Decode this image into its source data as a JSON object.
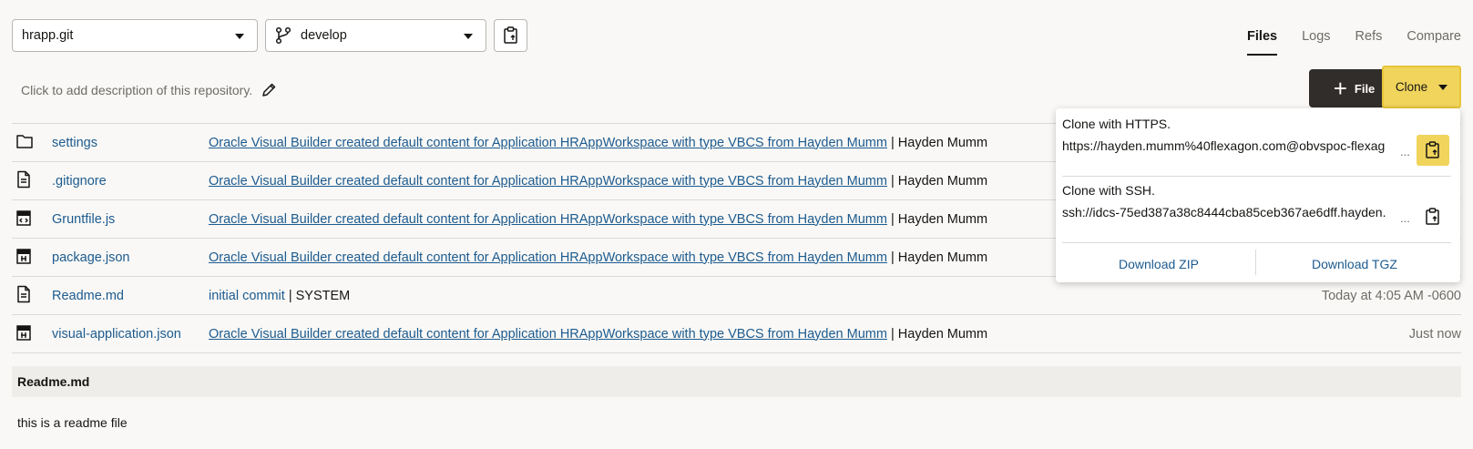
{
  "repo_select": {
    "value": "hrapp.git"
  },
  "branch_select": {
    "value": "develop"
  },
  "tabs": [
    {
      "label": "Files",
      "active": true
    },
    {
      "label": "Logs",
      "active": false
    },
    {
      "label": "Refs",
      "active": false
    },
    {
      "label": "Compare",
      "active": false
    }
  ],
  "description_placeholder": "Click to add description of this repository.",
  "actions": {
    "file_label": "File",
    "clone_label": "Clone"
  },
  "files": [
    {
      "icon": "folder-icon",
      "name": "settings",
      "message": "Oracle Visual Builder created default content for Application HRAppWorkspace with type VBCS from Hayden Mumm",
      "author": "Hayden Mumm",
      "time": ""
    },
    {
      "icon": "document-icon",
      "name": ".gitignore",
      "message": "Oracle Visual Builder created default content for Application HRAppWorkspace with type VBCS from Hayden Mumm",
      "author": "Hayden Mumm",
      "time": ""
    },
    {
      "icon": "js-file-icon",
      "name": "Gruntfile.js",
      "message": "Oracle Visual Builder created default content for Application HRAppWorkspace with type VBCS from Hayden Mumm",
      "author": "Hayden Mumm",
      "time": ""
    },
    {
      "icon": "json-file-icon",
      "name": "package.json",
      "message": "Oracle Visual Builder created default content for Application HRAppWorkspace with type VBCS from Hayden Mumm",
      "author": "Hayden Mumm",
      "time": ""
    },
    {
      "icon": "document-icon",
      "name": "Readme.md",
      "message": "initial commit",
      "author": "SYSTEM",
      "time": "Today at 4:05 AM -0600"
    },
    {
      "icon": "json-file-icon",
      "name": "visual-application.json",
      "message": "Oracle Visual Builder created default content for Application HRAppWorkspace with type VBCS from Hayden Mumm",
      "author": "Hayden Mumm",
      "time": "Just now"
    }
  ],
  "readme": {
    "title": "Readme.md",
    "content": "this is a readme file"
  },
  "clone_popup": {
    "https_label": "Clone with HTTPS.",
    "https_url": "https://hayden.mumm%40flexagon.com@obvspoc-flexag",
    "ssh_label": "Clone with SSH.",
    "ssh_url": "ssh://idcs-75ed387a38c8444cba85ceb367ae6dff.hayden.",
    "ellipsis": "...",
    "download_zip": "Download ZIP",
    "download_tgz": "Download TGZ"
  },
  "colors": {
    "accent": "#f0d45c",
    "link": "#1d5b8f",
    "dark_button": "#312d2a"
  }
}
